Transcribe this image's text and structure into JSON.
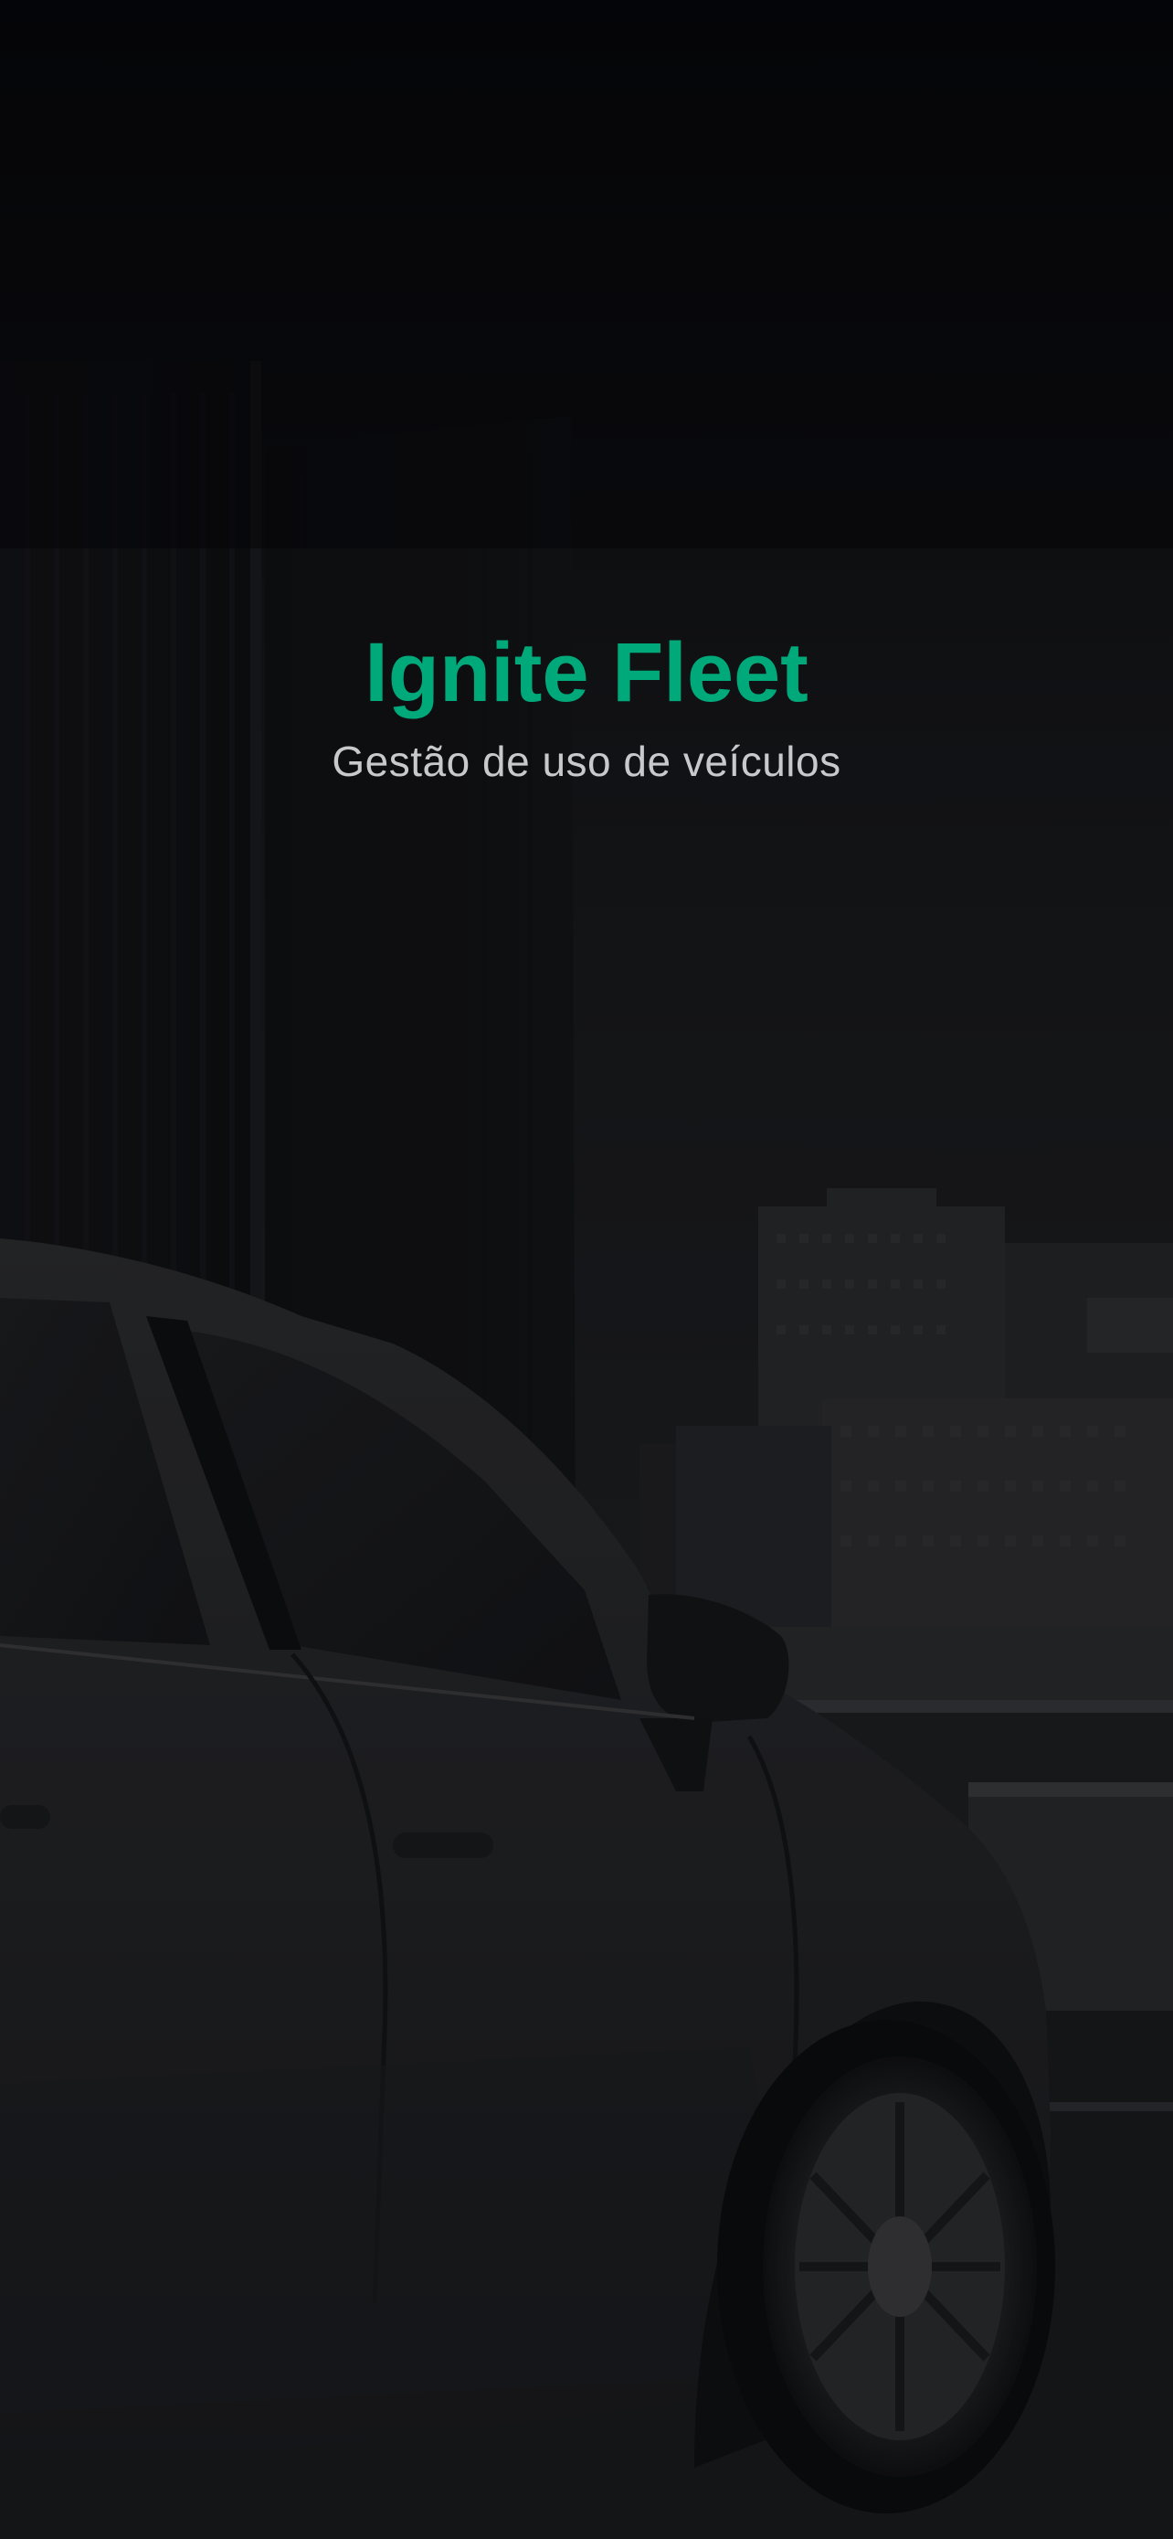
{
  "app": {
    "title": "Ignite Fleet",
    "subtitle": "Gestão de uso de veículos"
  },
  "colors": {
    "accent": "#00a97a",
    "subtitle_text": "#c8c9cc",
    "background_top": "#06070a",
    "background_bottom": "#1f2023"
  },
  "background_image": {
    "subject": "car-and-city-skyline-photo"
  }
}
